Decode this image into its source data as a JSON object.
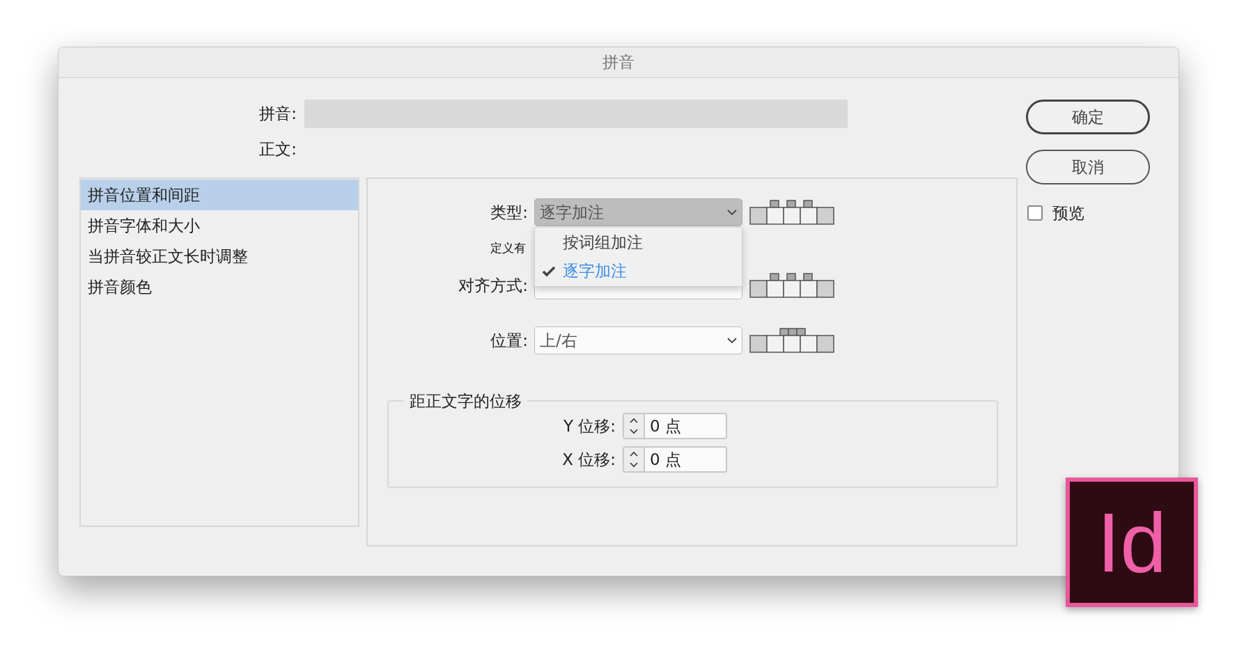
{
  "dialog": {
    "title": "拼音"
  },
  "ruby_field": {
    "label": "拼音:"
  },
  "base_text": {
    "label": "正文:"
  },
  "sidebar": {
    "items": [
      {
        "label": "拼音位置和间距",
        "selected": true
      },
      {
        "label": "拼音字体和大小",
        "selected": false
      },
      {
        "label": "当拼音较正文长时调整",
        "selected": false
      },
      {
        "label": "拼音颜色",
        "selected": false
      }
    ]
  },
  "settings": {
    "type": {
      "label": "类型:",
      "value": "逐字加注",
      "expanded": true,
      "options": [
        {
          "label": "按词组加注",
          "selected": false
        },
        {
          "label": "逐字加注",
          "selected": true
        }
      ]
    },
    "spacing_label": "定义有",
    "alignment": {
      "label": "对齐方式:"
    },
    "position": {
      "label": "位置:",
      "value": "上/右"
    }
  },
  "offset_group": {
    "title": "距正文字的位移",
    "fields": [
      {
        "label": "Y 位移:",
        "value": "0 点"
      },
      {
        "label": "X 位移:",
        "value": "0 点"
      }
    ]
  },
  "buttons": [
    {
      "label": "确定",
      "default": true
    },
    {
      "label": "取消",
      "default": false
    }
  ],
  "preview": {
    "label": "预览",
    "checked": false
  },
  "logo": {
    "text": "Id"
  }
}
